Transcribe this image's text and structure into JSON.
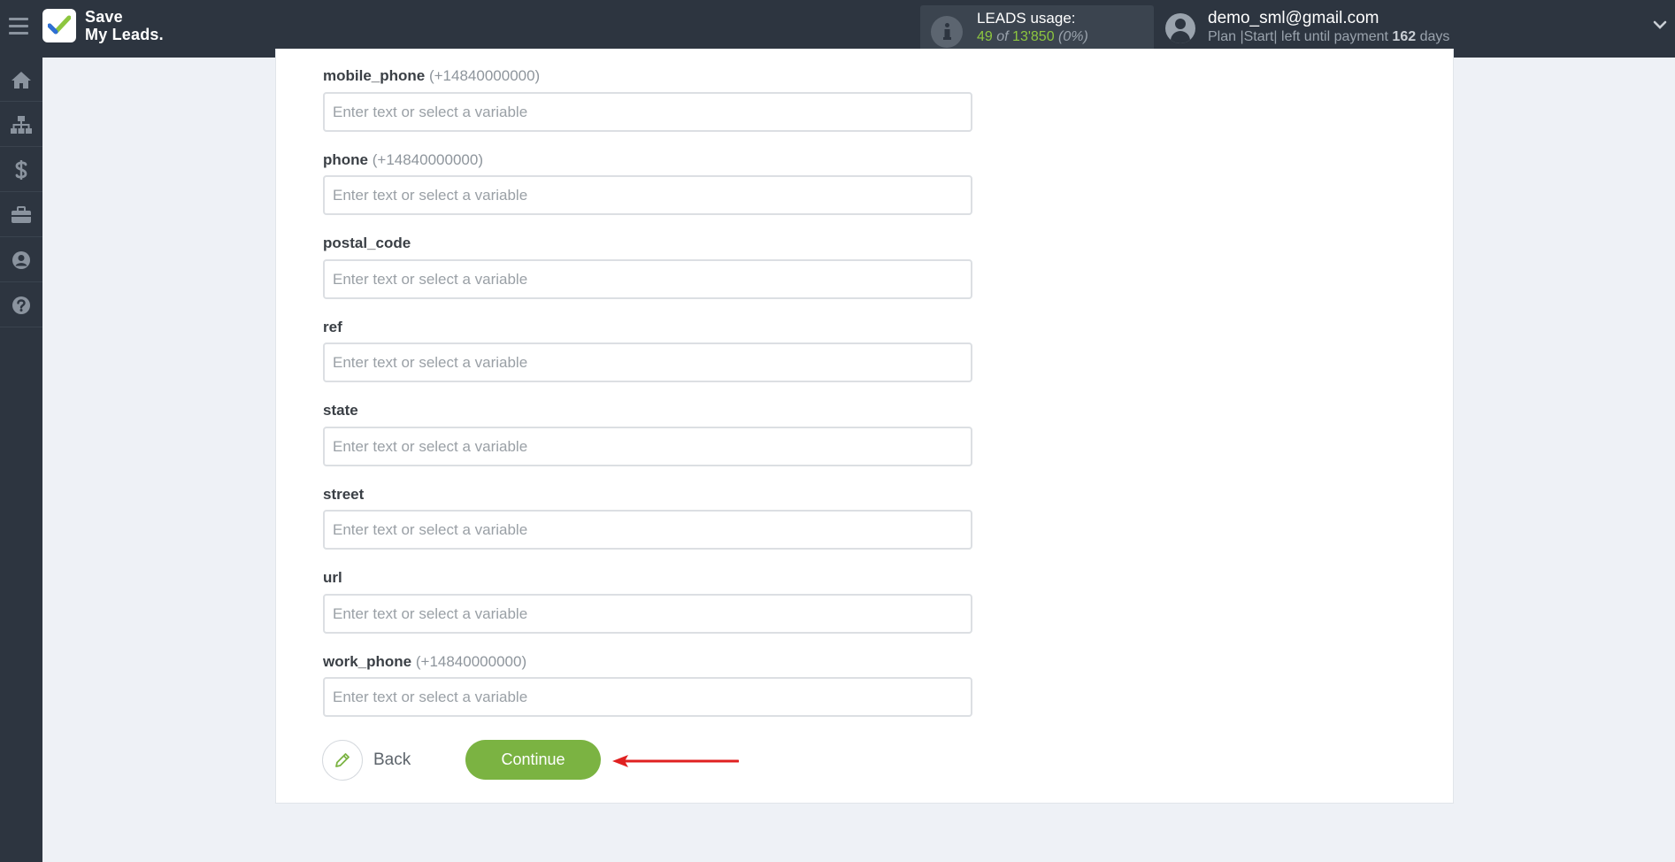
{
  "app": {
    "logo_line1": "Save",
    "logo_line2": "My Leads.",
    "brand_color": "#7bb342"
  },
  "usage": {
    "title": "LEADS usage:",
    "used": "49",
    "of": "of",
    "total": "13'850",
    "percent": "(0%)"
  },
  "account": {
    "email": "demo_sml@gmail.com",
    "plan_prefix": "Plan |Start| left until payment",
    "days_value": "162",
    "days_suffix": "days"
  },
  "sidebar": {
    "items": [
      {
        "icon": "home-icon"
      },
      {
        "icon": "sitemap-icon"
      },
      {
        "icon": "dollar-icon"
      },
      {
        "icon": "briefcase-icon"
      },
      {
        "icon": "user-circle-icon"
      },
      {
        "icon": "help-icon"
      }
    ]
  },
  "form": {
    "fields": [
      {
        "name": "mobile_phone",
        "hint": "(+14840000000)",
        "value": "",
        "placeholder": "Enter text or select a variable"
      },
      {
        "name": "phone",
        "hint": "(+14840000000)",
        "value": "",
        "placeholder": "Enter text or select a variable"
      },
      {
        "name": "postal_code",
        "hint": "",
        "value": "",
        "placeholder": "Enter text or select a variable"
      },
      {
        "name": "ref",
        "hint": "",
        "value": "",
        "placeholder": "Enter text or select a variable"
      },
      {
        "name": "state",
        "hint": "",
        "value": "",
        "placeholder": "Enter text or select a variable"
      },
      {
        "name": "street",
        "hint": "",
        "value": "",
        "placeholder": "Enter text or select a variable"
      },
      {
        "name": "url",
        "hint": "",
        "value": "",
        "placeholder": "Enter text or select a variable"
      },
      {
        "name": "work_phone",
        "hint": "(+14840000000)",
        "value": "",
        "placeholder": "Enter text or select a variable"
      }
    ],
    "back_label": "Back",
    "continue_label": "Continue"
  },
  "annotation": {
    "arrow_color": "#e02020"
  }
}
